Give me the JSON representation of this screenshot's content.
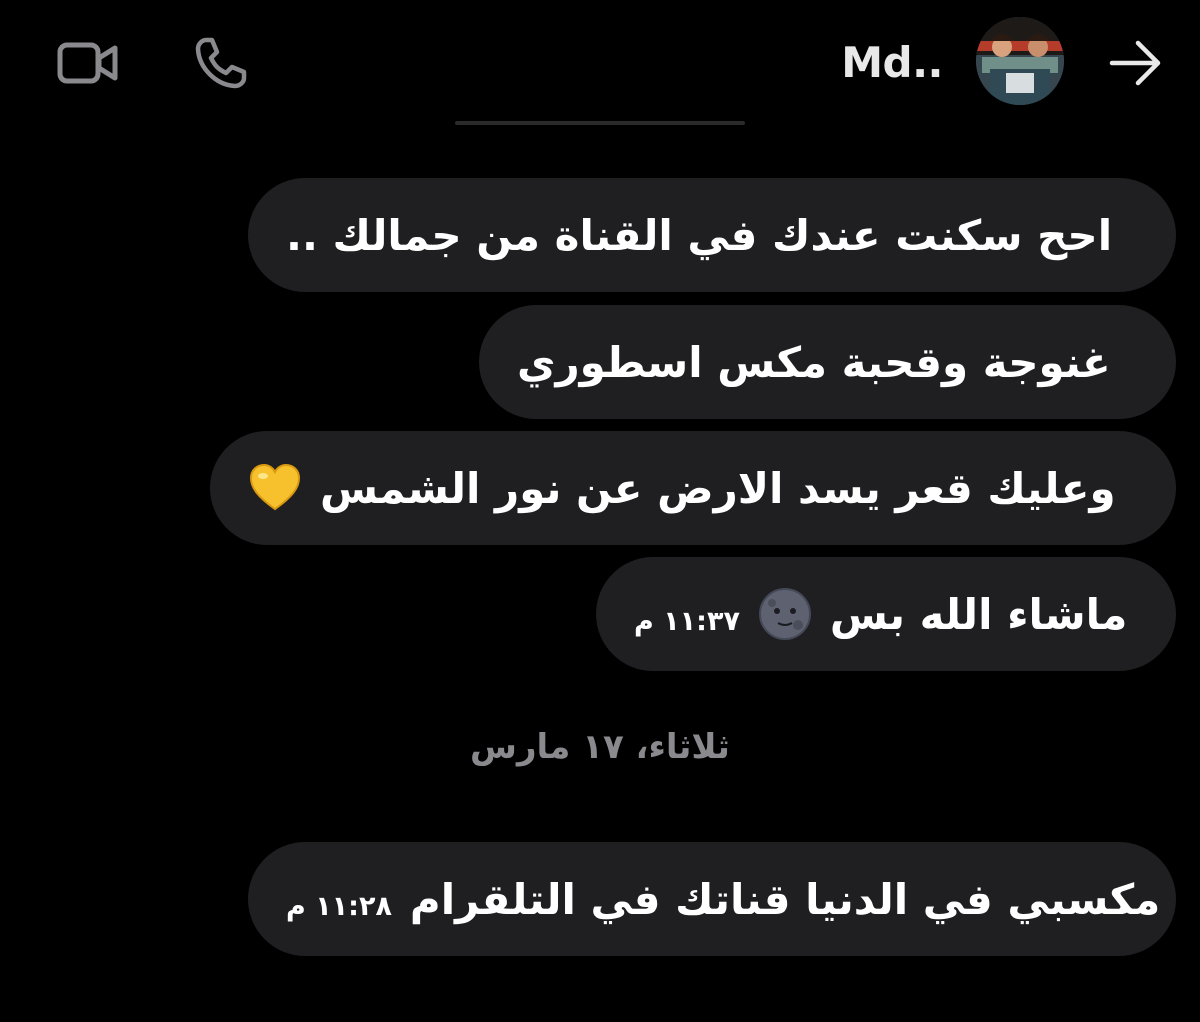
{
  "header": {
    "contact_name": "Md..",
    "icons": {
      "video": "video-camera-icon",
      "phone": "phone-icon",
      "back": "arrow-right-icon"
    }
  },
  "messages": [
    {
      "text": "احح سكنت عندك في القناة من جمالك ..",
      "time": "",
      "emoji": ""
    },
    {
      "text": "غنوجة وقحبة مكس اسطوري",
      "time": "",
      "emoji": ""
    },
    {
      "text": "وعليك قعر يسد الارض عن نور الشمس",
      "time": "",
      "emoji": "yellow-heart"
    },
    {
      "text": "ماشاء الله بس",
      "time": "١١:٣٧ م",
      "emoji": "new-moon-face"
    }
  ],
  "date_separator": "ثلاثاء، ١٧ مارس",
  "messages_after": [
    {
      "text": "مكسبي في الدنيا قناتك في التلقرام",
      "time": "١١:٢٨ م"
    }
  ],
  "colors": {
    "background": "#000000",
    "bubble": "#1f1f22",
    "text": "#ffffff",
    "muted": "#8a8a8e"
  }
}
